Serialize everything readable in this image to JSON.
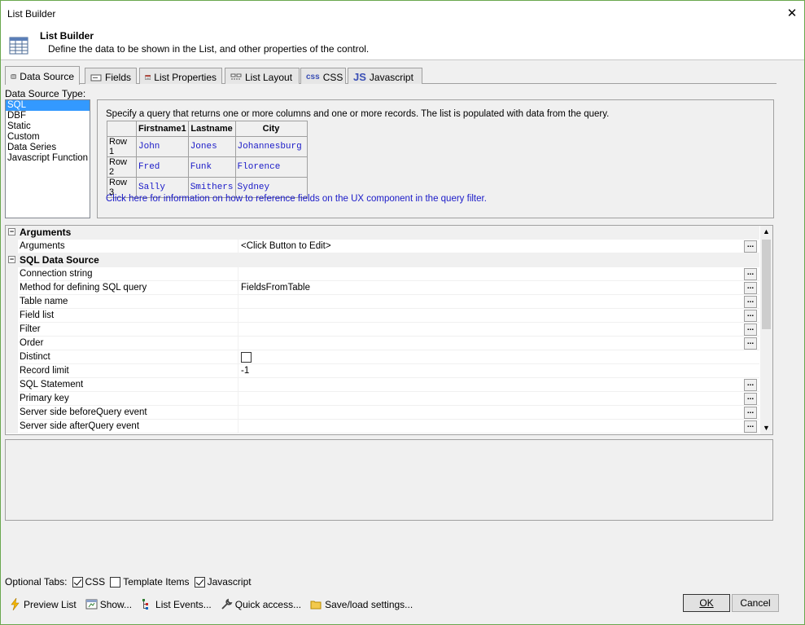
{
  "window": {
    "title": "List Builder",
    "close_glyph": "✕"
  },
  "header": {
    "title": "List Builder",
    "description": "Define the data to be shown in the List, and other properties of the control."
  },
  "tabs": [
    {
      "label": "Data Source",
      "icon": "database-icon"
    },
    {
      "label": "Fields",
      "icon": "field-icon"
    },
    {
      "label": "List Properties",
      "icon": "properties-icon"
    },
    {
      "label": "List Layout",
      "icon": "layout-icon"
    },
    {
      "label": "CSS",
      "icon": "css-icon",
      "prefix": "css"
    },
    {
      "label": "Javascript",
      "icon": "js-icon",
      "prefix": "JS"
    }
  ],
  "data_source": {
    "label": "Data Source Type:",
    "items": [
      "SQL",
      "DBF",
      "Static",
      "Custom",
      "Data Series",
      "Javascript Function"
    ],
    "selected": "SQL"
  },
  "info": {
    "text": "Specify a query that returns one or more columns and one or more records. The list is populated with data from the query.",
    "columns": [
      "Firstname1",
      "Lastname",
      "City"
    ],
    "rows": [
      {
        "label": "Row 1",
        "values": [
          "John",
          "Jones",
          "Johannesburg"
        ]
      },
      {
        "label": "Row 2",
        "values": [
          "Fred",
          "Funk",
          "Florence"
        ]
      },
      {
        "label": "Row 3",
        "values": [
          "Sally",
          "Smithers",
          "Sydney"
        ]
      }
    ],
    "link": "Click here for information on how to reference fields on the UX component in the query filter."
  },
  "grid": {
    "expander_glyph": "−",
    "dots": "...",
    "categories": {
      "arguments": "Arguments",
      "sql": "SQL Data Source"
    },
    "rows": {
      "arguments": {
        "name": "Arguments",
        "value": "<Click Button to Edit>"
      },
      "connection": {
        "name": "Connection string",
        "value": ""
      },
      "method": {
        "name": "Method for defining SQL query",
        "value": "FieldsFromTable"
      },
      "table": {
        "name": "Table name",
        "value": ""
      },
      "fieldlist": {
        "name": "Field list",
        "value": ""
      },
      "filter": {
        "name": "Filter",
        "value": ""
      },
      "order": {
        "name": "Order",
        "value": ""
      },
      "distinct": {
        "name": "Distinct",
        "value": ""
      },
      "limit": {
        "name": "Record limit",
        "value": "-1"
      },
      "sql": {
        "name": "SQL Statement",
        "value": ""
      },
      "pk": {
        "name": "Primary key",
        "value": ""
      },
      "before": {
        "name": "Server side beforeQuery event",
        "value": ""
      },
      "after": {
        "name": "Server side afterQuery event",
        "value": ""
      }
    },
    "scroll_up": "▲",
    "scroll_down": "▼"
  },
  "optional_tabs": {
    "label": "Optional Tabs:",
    "css": {
      "label": "CSS",
      "checked": true
    },
    "template": {
      "label": "Template Items",
      "checked": false
    },
    "javascript": {
      "label": "Javascript",
      "checked": true
    }
  },
  "bottom_bar": {
    "preview": "Preview List",
    "show": "Show...",
    "events": "List Events...",
    "quick": "Quick access...",
    "save": "Save/load settings..."
  },
  "buttons": {
    "ok": "OK",
    "cancel": "Cancel"
  }
}
